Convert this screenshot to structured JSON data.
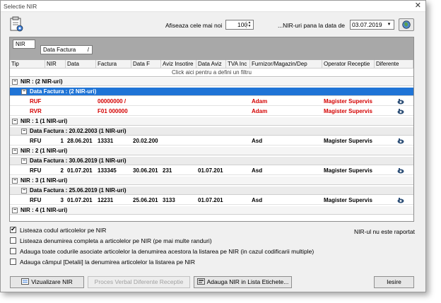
{
  "window": {
    "title": "Selectie NIR",
    "close_glyph": "✕"
  },
  "toolbar": {
    "show_last_label": "Afiseaza cele mai noi",
    "show_last_value": "100",
    "until_date_label": "...NIR-uri pana la data de",
    "until_date_value": "03.07.2019",
    "app_icon": "document-settings-icon",
    "globe_icon": "globe-icon"
  },
  "grid": {
    "group_chips": [
      "NIR",
      "Data Factura"
    ],
    "columns": [
      "Tip",
      "NIR",
      "Data",
      "Factura",
      "Data F",
      "Aviz Insotire",
      "Data Aviz",
      "TVA Inc",
      "Furnizor/Magazin/Dep",
      "Operator Receptie",
      "Diferente"
    ],
    "filter_prompt": "Click aici pentru a defini un filtru",
    "rows": [
      {
        "kind": "g1",
        "text": "NIR : (2 NIR-uri)"
      },
      {
        "kind": "g2sel",
        "text": "Data Factura : (2 NIR-uri)"
      },
      {
        "kind": "data",
        "red": true,
        "tip": "RUF",
        "nir": "",
        "data": "",
        "factura": "00000000 /",
        "dataf": "",
        "aviz": "",
        "dataaviz": "",
        "furnizor": "Adam",
        "operator": "Magister Supervis"
      },
      {
        "kind": "data",
        "red": true,
        "tip": "RVR",
        "nir": "",
        "data": "",
        "factura": "F01 000000",
        "dataf": "",
        "aviz": "",
        "dataaviz": "",
        "furnizor": "Adam",
        "operator": "Magister Supervis"
      },
      {
        "kind": "g1",
        "text": "NIR : 1 (1 NIR-uri)"
      },
      {
        "kind": "g2",
        "text": "Data Factura : 20.02.2003 (1 NIR-uri)"
      },
      {
        "kind": "data",
        "red": false,
        "tip": "RFU",
        "nir": "1",
        "data": "28.06.201",
        "factura": "13331",
        "dataf": "20.02.200",
        "aviz": "",
        "dataaviz": "",
        "furnizor": "Asd",
        "operator": "Magister Supervis"
      },
      {
        "kind": "g1",
        "text": "NIR : 2 (1 NIR-uri)"
      },
      {
        "kind": "g2",
        "text": "Data Factura : 30.06.2019 (1 NIR-uri)"
      },
      {
        "kind": "data",
        "red": false,
        "tip": "RFU",
        "nir": "2",
        "data": "01.07.201",
        "factura": "133345",
        "dataf": "30.06.201",
        "aviz": "231",
        "dataaviz": "01.07.201",
        "furnizor": "Asd",
        "operator": "Magister Supervis"
      },
      {
        "kind": "g1",
        "text": "NIR : 3 (1 NIR-uri)"
      },
      {
        "kind": "g2",
        "text": "Data Factura : 25.06.2019 (1 NIR-uri)"
      },
      {
        "kind": "data",
        "red": false,
        "tip": "RFU",
        "nir": "3",
        "data": "01.07.201",
        "factura": "12231",
        "dataf": "25.06.201",
        "aviz": "3133",
        "dataaviz": "01.07.201",
        "furnizor": "Asd",
        "operator": "Magister Supervis"
      },
      {
        "kind": "g1",
        "text": "NIR : 4 (1 NIR-uri)"
      }
    ],
    "diff_icon": "eye-icon",
    "accent_color": "#1f74d6",
    "red_color": "#d40000"
  },
  "options": {
    "list_codes": {
      "label": "Listeaza codul articolelor pe NIR",
      "checked": true
    },
    "status_text": "NIR-ul nu este raportat",
    "list_full_name": {
      "label": "Listeaza denumirea completa a articolelor pe NIR (pe mai multe randuri)",
      "checked": false
    },
    "add_codes": {
      "label": "Adauga toate codurile asociate articolelor la denumirea acestora la listarea pe NIR (in cazul codificarii multiple)",
      "checked": false
    },
    "add_details": {
      "label": "Adauga câmpul [Detalii] la denumirea articolelor la listarea pe NIR",
      "checked": false
    }
  },
  "buttons": {
    "preview": "Vizualizare NIR",
    "diff_report": "Proces Verbal Diferente Receptie",
    "add_labels": "Adauga NIR in Lista Etichete...",
    "exit": "Iesire"
  }
}
